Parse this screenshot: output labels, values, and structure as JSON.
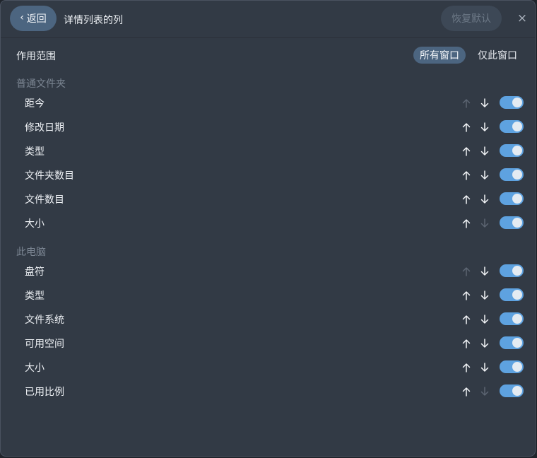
{
  "header": {
    "back_label": "返回",
    "title": "详情列表的列",
    "reset_label": "恢复默认",
    "close_glyph": "×"
  },
  "scope": {
    "label": "作用范围",
    "options": [
      "所有窗口",
      "仅此窗口"
    ],
    "selected": "所有窗口"
  },
  "sections": [
    {
      "title": "普通文件夹",
      "rows": [
        {
          "label": "距今",
          "up_enabled": false,
          "down_enabled": true,
          "on": true
        },
        {
          "label": "修改日期",
          "up_enabled": true,
          "down_enabled": true,
          "on": true
        },
        {
          "label": "类型",
          "up_enabled": true,
          "down_enabled": true,
          "on": true
        },
        {
          "label": "文件夹数目",
          "up_enabled": true,
          "down_enabled": true,
          "on": true
        },
        {
          "label": "文件数目",
          "up_enabled": true,
          "down_enabled": true,
          "on": true
        },
        {
          "label": "大小",
          "up_enabled": true,
          "down_enabled": false,
          "on": true
        }
      ]
    },
    {
      "title": "此电脑",
      "rows": [
        {
          "label": "盘符",
          "up_enabled": false,
          "down_enabled": true,
          "on": true
        },
        {
          "label": "类型",
          "up_enabled": true,
          "down_enabled": true,
          "on": true
        },
        {
          "label": "文件系统",
          "up_enabled": true,
          "down_enabled": true,
          "on": true
        },
        {
          "label": "可用空间",
          "up_enabled": true,
          "down_enabled": true,
          "on": true
        },
        {
          "label": "大小",
          "up_enabled": true,
          "down_enabled": true,
          "on": true
        },
        {
          "label": "已用比例",
          "up_enabled": true,
          "down_enabled": false,
          "on": true
        }
      ]
    }
  ],
  "icons": {
    "back": "chevron-left-icon",
    "close": "close-icon",
    "up": "arrow-up-icon",
    "down": "arrow-down-icon"
  },
  "colors": {
    "accent": "#5ea2e0",
    "button_active": "#4c6580",
    "panel": "#323a45"
  }
}
